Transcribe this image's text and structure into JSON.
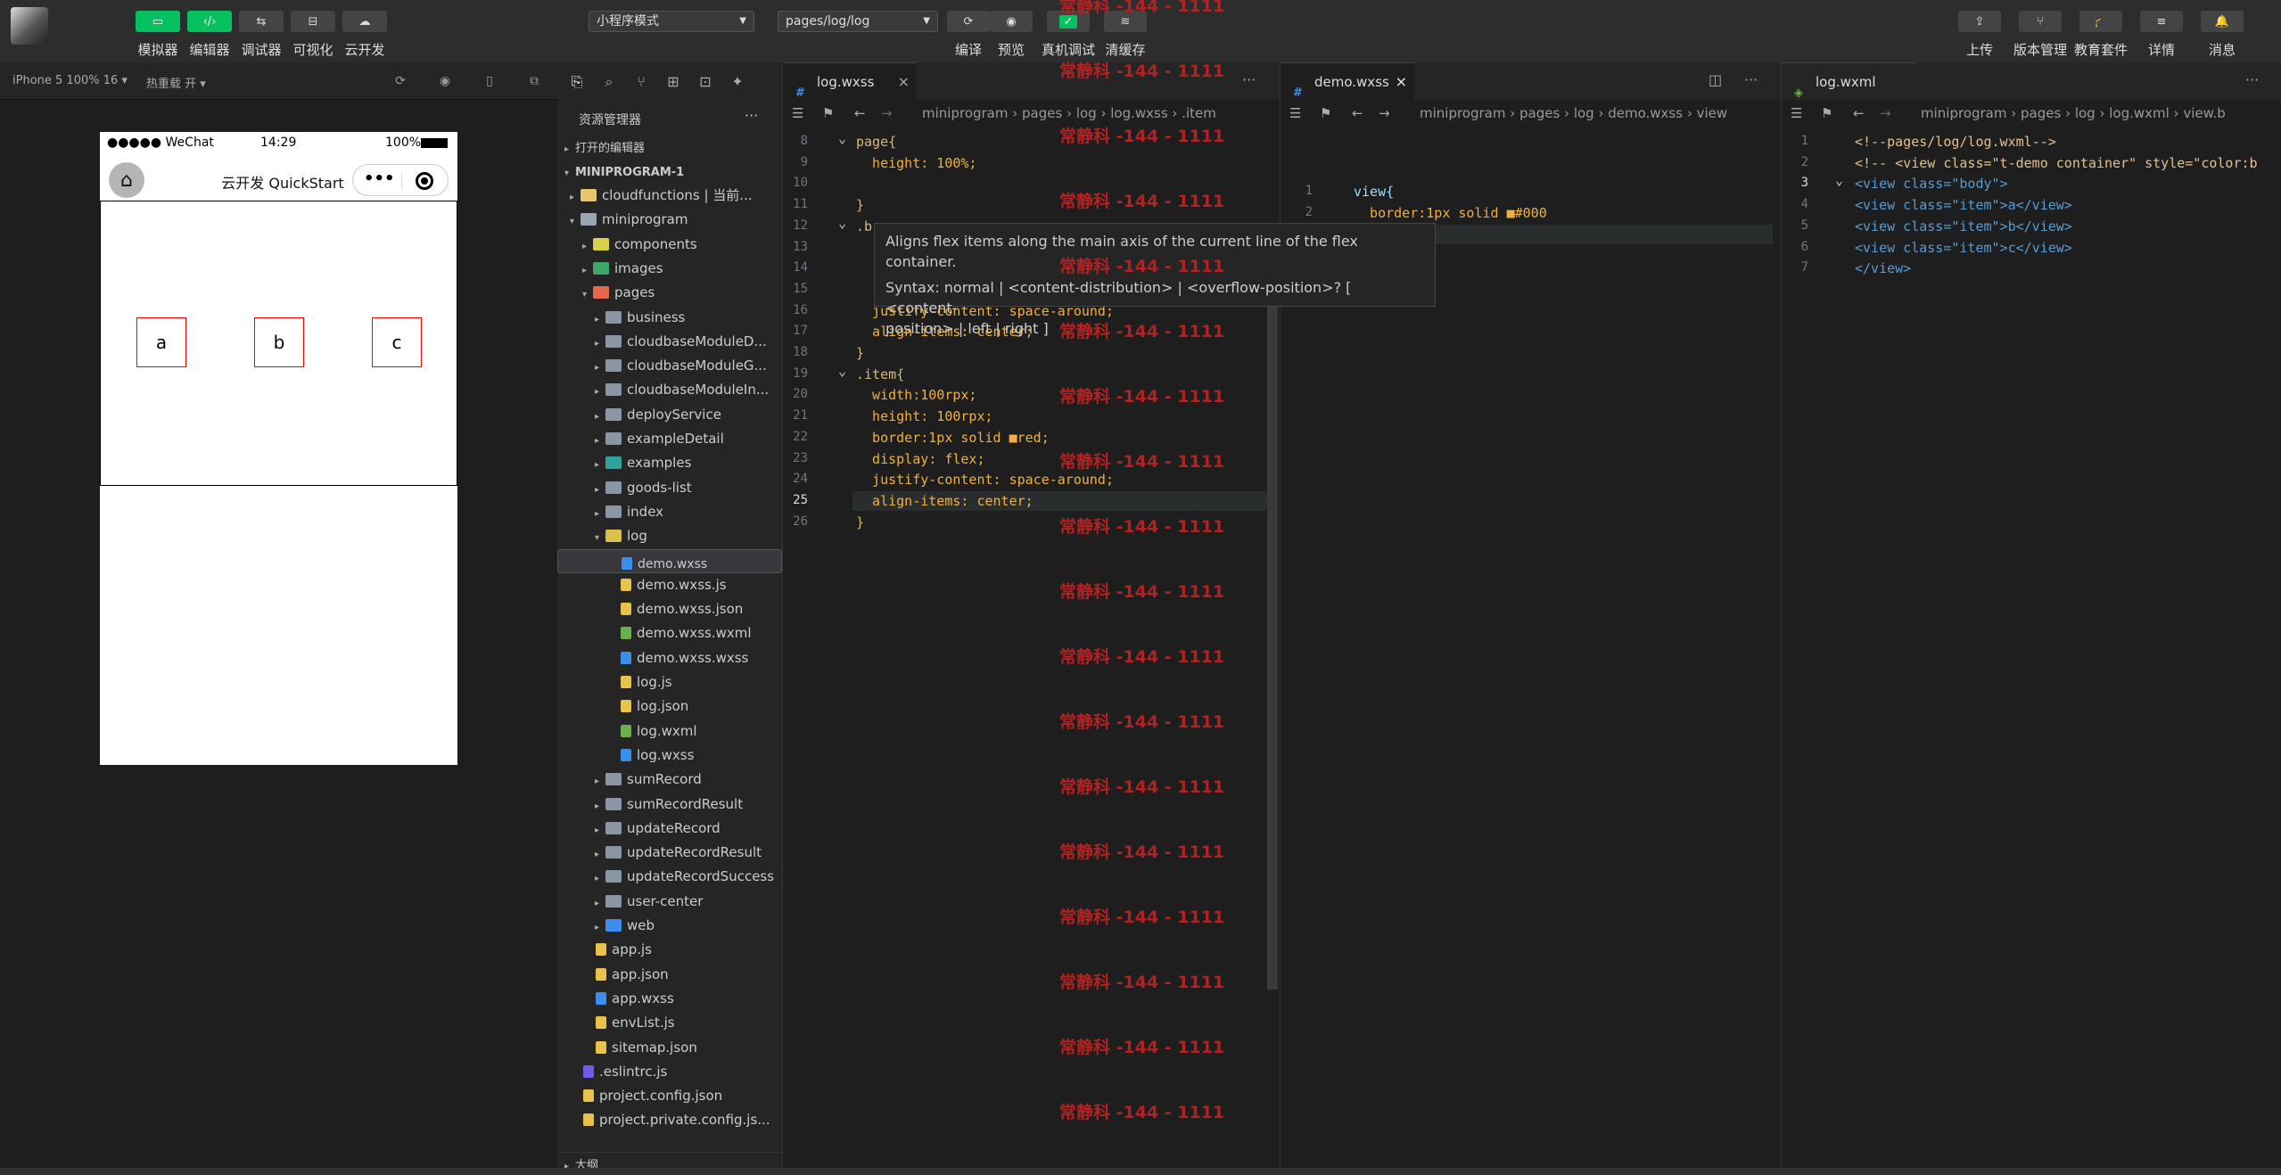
{
  "toolbar": {
    "buttons": [
      {
        "label": "模拟器",
        "icon": "phone-icon",
        "active": true
      },
      {
        "label": "编辑器",
        "icon": "code-icon",
        "active": true
      },
      {
        "label": "调试器",
        "icon": "debug-icon",
        "active": false
      },
      {
        "label": "可视化",
        "icon": "layout-icon",
        "active": false
      },
      {
        "label": "云开发",
        "icon": "cloud-icon",
        "active": false
      }
    ],
    "mode_select": "小程序模式",
    "page_select": "pages/log/log",
    "center_buttons": [
      {
        "label": "编译",
        "icon": "refresh-icon"
      },
      {
        "label": "预览",
        "icon": "eye-icon"
      },
      {
        "label": "真机调试",
        "icon": "check-icon"
      },
      {
        "label": "清缓存",
        "icon": "layers-icon"
      }
    ],
    "right_buttons": [
      {
        "label": "上传",
        "icon": "upload-icon"
      },
      {
        "label": "版本管理",
        "icon": "branch-icon"
      },
      {
        "label": "教育套件",
        "icon": "graduation-icon"
      },
      {
        "label": "详情",
        "icon": "menu-icon"
      },
      {
        "label": "消息",
        "icon": "bell-icon"
      }
    ]
  },
  "simulator": {
    "device": "iPhone 5 100% 16 ▾",
    "hot_reload": "热重载 开 ▾",
    "status_left": "●●●●● WeChat",
    "status_time": "14:29",
    "status_battery": "100%",
    "nav_title": "云开发 QuickStart",
    "items": [
      "a",
      "b",
      "c"
    ]
  },
  "explorer": {
    "title": "资源管理器",
    "open_editors": "打开的编辑器",
    "root": "MINIPROGRAM-1",
    "outline": "大纲",
    "rows": [
      {
        "label": "cloudfunctions | 当前...",
        "indent": 1,
        "arrow": "▸",
        "color": "#e8c56d"
      },
      {
        "label": "miniprogram",
        "indent": 1,
        "arrow": "▾",
        "color": "#9aa5b1"
      },
      {
        "label": "components",
        "indent": 2,
        "arrow": "▸",
        "color": "#d8d24a"
      },
      {
        "label": "images",
        "indent": 2,
        "arrow": "▸",
        "color": "#3fa66a"
      },
      {
        "label": "pages",
        "indent": 2,
        "arrow": "▾",
        "color": "#e4684c"
      },
      {
        "label": "business",
        "indent": 3,
        "arrow": "▸",
        "color": "#8a96a3"
      },
      {
        "label": "cloudbaseModuleD...",
        "indent": 3,
        "arrow": "▸",
        "color": "#8a96a3"
      },
      {
        "label": "cloudbaseModuleG...",
        "indent": 3,
        "arrow": "▸",
        "color": "#8a96a3"
      },
      {
        "label": "cloudbaseModuleIn...",
        "indent": 3,
        "arrow": "▸",
        "color": "#8a96a3"
      },
      {
        "label": "deployService",
        "indent": 3,
        "arrow": "▸",
        "color": "#8a96a3"
      },
      {
        "label": "exampleDetail",
        "indent": 3,
        "arrow": "▸",
        "color": "#8a96a3"
      },
      {
        "label": "examples",
        "indent": 3,
        "arrow": "▸",
        "color": "#2fa39a"
      },
      {
        "label": "goods-list",
        "indent": 3,
        "arrow": "▸",
        "color": "#8a96a3"
      },
      {
        "label": "index",
        "indent": 3,
        "arrow": "▸",
        "color": "#8a96a3"
      },
      {
        "label": "log",
        "indent": 3,
        "arrow": "▾",
        "color": "#d8c24a"
      },
      {
        "label": "demo.wxss",
        "indent": 4,
        "arrow": "",
        "color": "#3b8eea",
        "selected": true
      },
      {
        "label": "demo.wxss.js",
        "indent": 4,
        "arrow": "",
        "color": "#e8c24a"
      },
      {
        "label": "demo.wxss.json",
        "indent": 4,
        "arrow": "",
        "color": "#e8c24a"
      },
      {
        "label": "demo.wxss.wxml",
        "indent": 4,
        "arrow": "",
        "color": "#6ab04c"
      },
      {
        "label": "demo.wxss.wxss",
        "indent": 4,
        "arrow": "",
        "color": "#3b8eea"
      },
      {
        "label": "log.js",
        "indent": 4,
        "arrow": "",
        "color": "#e8c24a"
      },
      {
        "label": "log.json",
        "indent": 4,
        "arrow": "",
        "color": "#e8c24a"
      },
      {
        "label": "log.wxml",
        "indent": 4,
        "arrow": "",
        "color": "#6ab04c"
      },
      {
        "label": "log.wxss",
        "indent": 4,
        "arrow": "",
        "color": "#3b8eea"
      },
      {
        "label": "sumRecord",
        "indent": 3,
        "arrow": "▸",
        "color": "#8a96a3"
      },
      {
        "label": "sumRecordResult",
        "indent": 3,
        "arrow": "▸",
        "color": "#8a96a3"
      },
      {
        "label": "updateRecord",
        "indent": 3,
        "arrow": "▸",
        "color": "#8a96a3"
      },
      {
        "label": "updateRecordResult",
        "indent": 3,
        "arrow": "▸",
        "color": "#8a96a3"
      },
      {
        "label": "updateRecordSuccess",
        "indent": 3,
        "arrow": "▸",
        "color": "#8a96a3"
      },
      {
        "label": "user-center",
        "indent": 3,
        "arrow": "▸",
        "color": "#8a96a3"
      },
      {
        "label": "web",
        "indent": 3,
        "arrow": "▸",
        "color": "#3b8eea"
      },
      {
        "label": "app.js",
        "indent": 2,
        "arrow": "",
        "color": "#e8c24a"
      },
      {
        "label": "app.json",
        "indent": 2,
        "arrow": "",
        "color": "#e8c24a"
      },
      {
        "label": "app.wxss",
        "indent": 2,
        "arrow": "",
        "color": "#3b8eea"
      },
      {
        "label": "envList.js",
        "indent": 2,
        "arrow": "",
        "color": "#e8c24a"
      },
      {
        "label": "sitemap.json",
        "indent": 2,
        "arrow": "",
        "color": "#e8c24a"
      },
      {
        "label": ".eslintrc.js",
        "indent": 1,
        "arrow": "",
        "color": "#6c5ce7"
      },
      {
        "label": "project.config.json",
        "indent": 1,
        "arrow": "",
        "color": "#e8c24a"
      },
      {
        "label": "project.private.config.js...",
        "indent": 1,
        "arrow": "",
        "color": "#e8c24a"
      }
    ]
  },
  "editor1": {
    "tab": "log.wxss",
    "breadcrumb": "miniprogram  ›  pages  ›  log  ›  log.wxss  ›  .item",
    "lines": [
      {
        "n": "8",
        "text": "page{",
        "cls": "sel-prop"
      },
      {
        "n": "9",
        "text": "  height: 100%;",
        "cls": "prop"
      },
      {
        "n": "10",
        "text": "",
        "cls": ""
      },
      {
        "n": "11",
        "text": "}",
        "cls": "sel-prop"
      },
      {
        "n": "12",
        "text": ".b",
        "cls": "sel-prop"
      },
      {
        "n": "13",
        "text": "",
        "cls": ""
      },
      {
        "n": "14",
        "text": "",
        "cls": ""
      },
      {
        "n": "15",
        "text": "",
        "cls": ""
      },
      {
        "n": "16",
        "text": "  justify-content: space-around;",
        "cls": "prop"
      },
      {
        "n": "17",
        "text": "  align-items: center;",
        "cls": "prop"
      },
      {
        "n": "18",
        "text": "}",
        "cls": "sel-prop"
      },
      {
        "n": "19",
        "text": ".item{",
        "cls": "sel-prop"
      },
      {
        "n": "20",
        "text": "  width:100rpx;",
        "cls": "prop"
      },
      {
        "n": "21",
        "text": "  height: 100rpx;",
        "cls": "prop"
      },
      {
        "n": "22",
        "text": "  border:1px solid ■red;",
        "cls": "prop"
      },
      {
        "n": "23",
        "text": "  display: flex;",
        "cls": "prop"
      },
      {
        "n": "24",
        "text": "  justify-content: space-around;",
        "cls": "prop"
      },
      {
        "n": "25",
        "text": "  align-items: center;",
        "cls": "prop"
      },
      {
        "n": "26",
        "text": "}",
        "cls": "sel-prop"
      }
    ],
    "tooltip_line1": "Aligns flex items along the main axis of the current line of the flex container.",
    "tooltip_line2": "Syntax: normal | <content-distribution> | <overflow-position>? [ <content-",
    "tooltip_line3": "position> | left | right ]"
  },
  "editor2": {
    "tab": "demo.wxss",
    "breadcrumb": "miniprogram  ›  pages  ›  log  ›  demo.wxss  ›  view",
    "lines": [
      {
        "n": "1",
        "text": "view{"
      },
      {
        "n": "2",
        "text": "  border:1px solid ■#000"
      },
      {
        "n": "3",
        "text": "}"
      }
    ]
  },
  "editor3": {
    "tab": "log.wxml",
    "breadcrumb": "miniprogram  ›  pages  ›  log  ›  log.wxml  ›  view.b",
    "lines": [
      {
        "n": "1",
        "text": "<!--pages/log/log.wxml-->"
      },
      {
        "n": "2",
        "text": "<!-- <view class=\"t-demo container\" style=\"color:b"
      },
      {
        "n": "3",
        "text": "<view class=\"body\">"
      },
      {
        "n": "4",
        "text": "<view class=\"item\">a</view>"
      },
      {
        "n": "5",
        "text": "<view class=\"item\">b</view>"
      },
      {
        "n": "6",
        "text": "<view class=\"item\">c</view>"
      },
      {
        "n": "7",
        "text": "</view>"
      }
    ]
  },
  "watermark": "常静科 -144 - 1111"
}
